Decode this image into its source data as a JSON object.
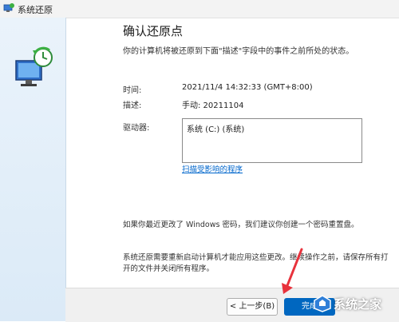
{
  "window": {
    "title": "系统还原"
  },
  "page": {
    "heading": "确认还原点",
    "description": "你的计算机将被还原到下面\"描述\"字段中的事件之前所处的状态。"
  },
  "restore_point": {
    "time_label": "时间:",
    "time_value": "2021/11/4 14:32:33 (GMT+8:00)",
    "description_label": "描述:",
    "description_value": "手动: 20211104",
    "drives_label": "驱动器:",
    "drives": [
      "系统 (C:) (系统)"
    ],
    "scan_link": "扫描受影响的程序"
  },
  "notes": {
    "password_note": "如果你最近更改了 Windows 密码，我们建议你创建一个密码重置盘。",
    "restart_note": "系统还原需要重新启动计算机才能应用这些更改。继续操作之前，请保存所有打开的文件并关闭所有程序。"
  },
  "buttons": {
    "back": "< 上一步(B)",
    "finish": "完成"
  },
  "watermark": "系统之家",
  "colors": {
    "accent": "#0067c0",
    "link": "#0066cc",
    "sidebar": "#dbeaf7",
    "arrow": "#e8323c"
  }
}
